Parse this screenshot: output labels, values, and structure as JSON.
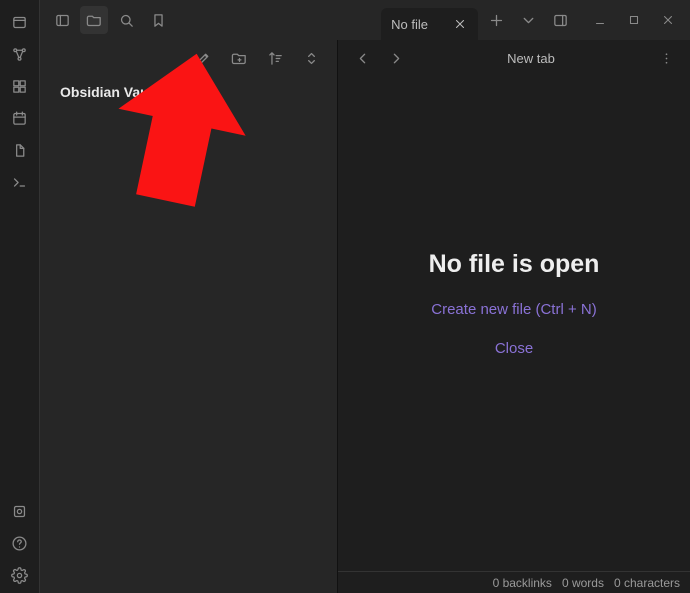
{
  "tab": {
    "label": "No file"
  },
  "editor": {
    "header_title": "New tab",
    "no_file_heading": "No file is open",
    "create_link": "Create new file (Ctrl + N)",
    "close_link": "Close"
  },
  "vault": {
    "title": "Obsidian Vault"
  },
  "status": {
    "backlinks": "0 backlinks",
    "words": "0 words",
    "characters": "0 characters"
  }
}
